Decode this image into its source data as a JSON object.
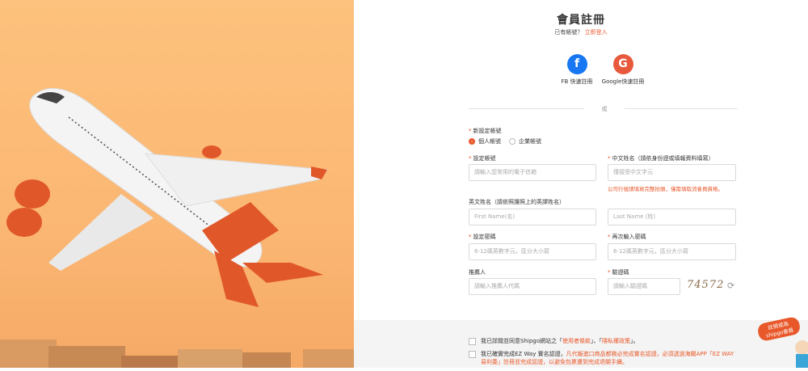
{
  "header": {
    "title": "會員註冊",
    "subtitle_text": "已有帳號？",
    "login_link": "立即登入"
  },
  "social": {
    "fb_label": "FB 快速註冊",
    "google_label": "Google快速註冊",
    "fb_glyph": "f",
    "google_glyph": "G"
  },
  "divider": {
    "or_label": "或"
  },
  "form": {
    "account_type_label": "新設定帳號",
    "account_type_options": [
      "個人帳號",
      "企業帳號"
    ],
    "account_type_selected": "個人帳號",
    "account_label": "設定帳號",
    "account_placeholder": "請輸入您常用的電子信箱",
    "chinese_name_label": "中文姓名（請依身份證或填報資料填寫）",
    "chinese_name_placeholder": "僅接受中文字元",
    "chinese_name_hint": "公司行號請填寫完整抬頭，僅需填取消會員資格。",
    "english_name_label": "英文姓名（請依照護照上的英譯姓名）",
    "first_name_placeholder": "First Name(名)",
    "last_name_placeholder": "Last Name (姓)",
    "password_label": "設定密碼",
    "password_placeholder": "6-12碼英數字元，區分大小寫",
    "password_confirm_label": "再次輸入密碼",
    "password_confirm_placeholder": "6-12碼英數字元，區分大小寫",
    "referrer_label": "推薦人",
    "referrer_placeholder": "請輸入推薦人代碼",
    "captcha_label": "驗證碼",
    "captcha_placeholder": "請輸入驗證碼",
    "captcha_value": "74572"
  },
  "footer": {
    "terms1_a": "我已詳閱並同意Shipgo網站之「",
    "terms1_link1": "使用者條款",
    "terms1_b": "」、「",
    "terms1_link2": "隱私權政策",
    "terms1_c": "」。",
    "terms2_a": "我已確實完成EZ Way 實名認證，",
    "terms2_o": "凡代報進口商品都務必完成實名認證，必須透過海關APP「EZ WAY易利委」註冊並完成認證，以避免包裹遭到完成退關手續。"
  },
  "badge": {
    "line1": "註冊成為",
    "line2": "shipgo會員"
  },
  "colors": {
    "accent": "#e8582a",
    "facebook": "#1877f2",
    "google": "#e8583c"
  }
}
